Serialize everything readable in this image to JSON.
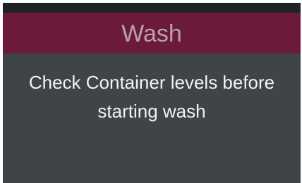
{
  "dialog": {
    "title": "Wash",
    "message_lines": [
      "Check Container levels before",
      "starting wash"
    ]
  },
  "colors": {
    "top_strip": "#1e2226",
    "title_bar": "#6b1a3a",
    "title_text": "#b7a0ab",
    "panel": "#3f4446",
    "message_text": "#f3f3f3"
  }
}
